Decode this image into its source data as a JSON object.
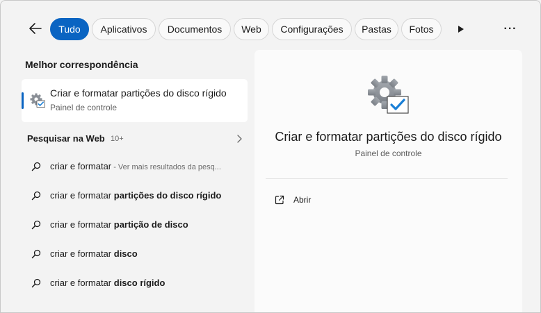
{
  "filters": {
    "back_icon": "arrow-left-icon",
    "items": [
      {
        "label": "Tudo",
        "active": true
      },
      {
        "label": "Aplicativos",
        "active": false
      },
      {
        "label": "Documentos",
        "active": false
      },
      {
        "label": "Web",
        "active": false
      },
      {
        "label": "Configurações",
        "active": false
      },
      {
        "label": "Pastas",
        "active": false
      },
      {
        "label": "Fotos",
        "active": false
      }
    ],
    "more_icon": "play-right-icon",
    "options_label": "···"
  },
  "best_match": {
    "section_title": "Melhor correspondência",
    "title": "Criar e formatar partições do disco rígido",
    "subtitle": "Painel de controle",
    "icon": "settings-gear-check-icon"
  },
  "web_search": {
    "title": "Pesquisar na Web",
    "count": "10+",
    "suggestions": [
      {
        "prefix": "criar e formatar",
        "bold": "",
        "hint": " - Ver mais resultados da pesq..."
      },
      {
        "prefix": "criar e formatar ",
        "bold": "partições do disco rígido",
        "hint": ""
      },
      {
        "prefix": "criar e formatar ",
        "bold": "partição de disco",
        "hint": ""
      },
      {
        "prefix": "criar e formatar ",
        "bold": "disco",
        "hint": ""
      },
      {
        "prefix": "criar e formatar ",
        "bold": "disco rígido",
        "hint": ""
      }
    ]
  },
  "preview": {
    "title": "Criar e formatar partições do disco rígido",
    "subtitle": "Painel de controle",
    "actions": [
      {
        "label": "Abrir",
        "icon": "open-external-icon"
      }
    ]
  },
  "colors": {
    "accent": "#0a64c2",
    "background": "#f3f3f3",
    "panel": "#fbfbfb"
  }
}
